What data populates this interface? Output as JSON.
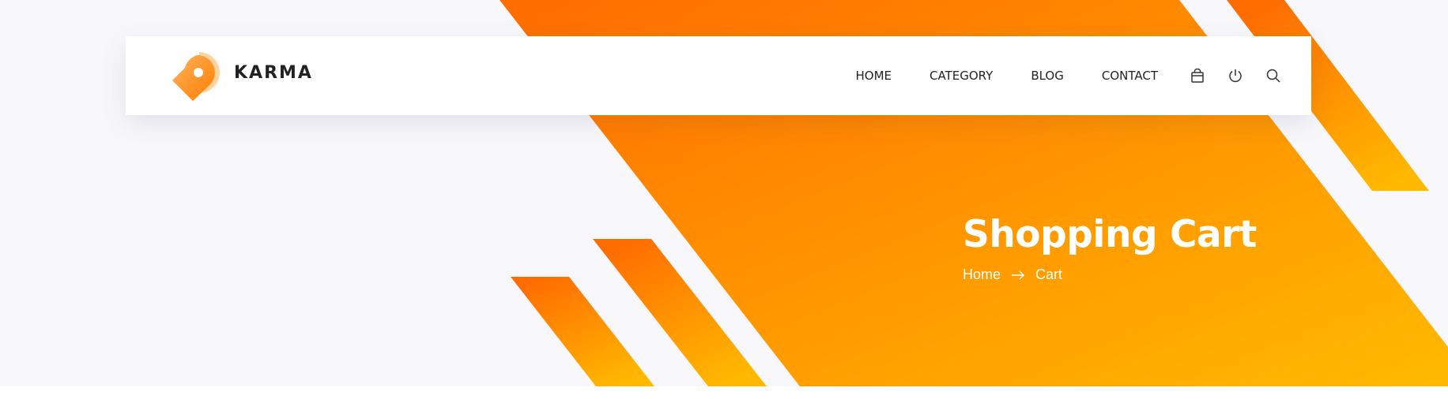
{
  "brand": {
    "name": "KARMA",
    "logo_icon": "map-pin-tag-logo",
    "accent_colors": [
      "#ff6c00",
      "#ffba00"
    ]
  },
  "nav": {
    "items": [
      {
        "label": "HOME"
      },
      {
        "label": "CATEGORY"
      },
      {
        "label": "BLOG"
      },
      {
        "label": "CONTACT"
      }
    ],
    "icons": [
      "shopping-bag-icon",
      "power-icon",
      "search-icon"
    ]
  },
  "hero": {
    "title": "Shopping Cart",
    "breadcrumb": [
      {
        "label": "Home"
      },
      {
        "label": "Cart"
      }
    ],
    "breadcrumb_separator_icon": "arrow-right-icon"
  },
  "colors": {
    "gradient_start": "#ff6c00",
    "gradient_end": "#ffba00",
    "page_background": "#f8f8fc",
    "text_dark": "#222222"
  }
}
